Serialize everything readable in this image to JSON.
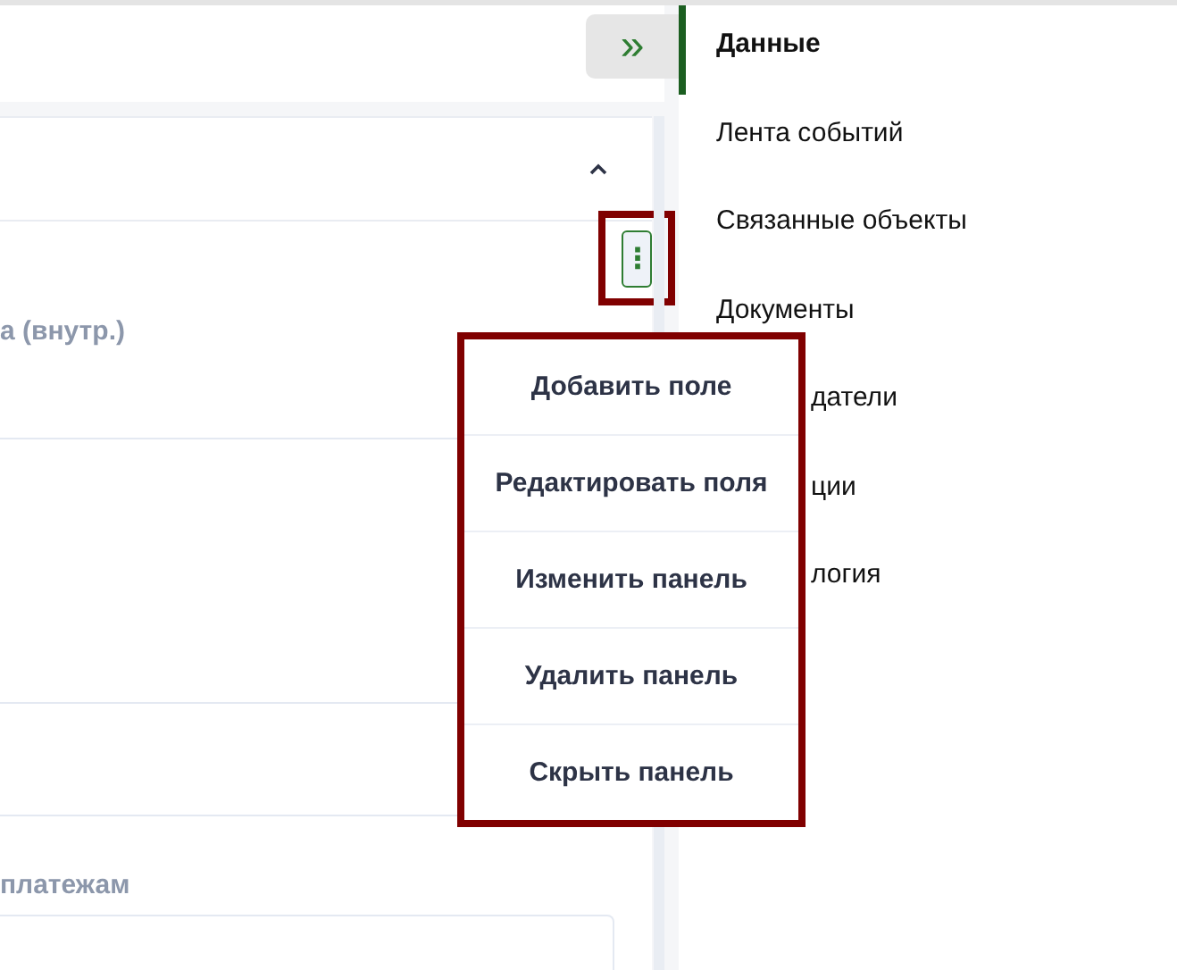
{
  "toolbar": {
    "collapse_button": "»"
  },
  "panel": {
    "fields": [
      {
        "label": "а (внутр.)"
      },
      {
        "label": "платежам"
      }
    ]
  },
  "kebab_button": {
    "label": "⋮",
    "highlighted": true
  },
  "menu": {
    "highlighted": true,
    "items": [
      {
        "label": "Добавить поле"
      },
      {
        "label": "Редактировать поля"
      },
      {
        "label": "Изменить панель"
      },
      {
        "label": "Удалить панель"
      },
      {
        "label": "Скрыть панель"
      }
    ]
  },
  "sidebar": {
    "items": [
      {
        "label": "Данные",
        "selected": true,
        "covered": false
      },
      {
        "label": "Лента событий",
        "selected": false,
        "covered": false
      },
      {
        "label": "Связанные объекты",
        "selected": false,
        "covered": false
      },
      {
        "label": "Документы",
        "selected": false,
        "covered": false
      },
      {
        "label": "датели",
        "selected": false,
        "covered": true
      },
      {
        "label": "ции",
        "selected": false,
        "covered": true
      },
      {
        "label": "логия",
        "selected": false,
        "covered": true
      }
    ]
  }
}
